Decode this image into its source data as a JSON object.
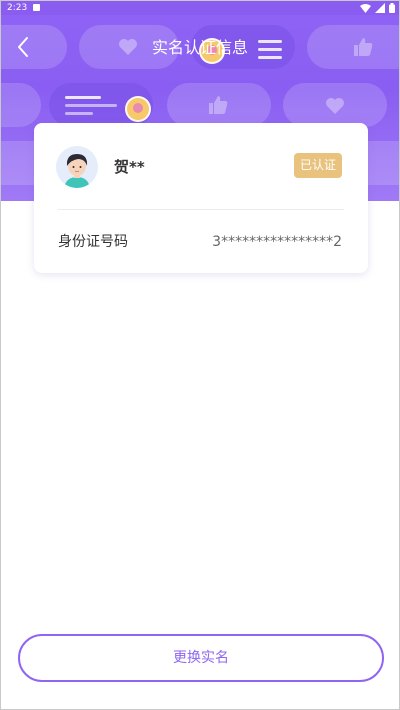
{
  "status_bar": {
    "time": "2:23",
    "icons": [
      "notification-icon",
      "wifi-icon",
      "signal-icon",
      "battery-icon"
    ]
  },
  "nav": {
    "title": "实名认证信息",
    "back_icon": "chevron-left-icon"
  },
  "card": {
    "user_name": "贺**",
    "verified_badge": "已认证",
    "id_label": "身份证号码",
    "id_value": "3****************2"
  },
  "actions": {
    "change_name_label": "更换实名"
  },
  "colors": {
    "header": "#8a5ef2",
    "accent": "#8f65f2",
    "badge": "#e9c27e"
  }
}
